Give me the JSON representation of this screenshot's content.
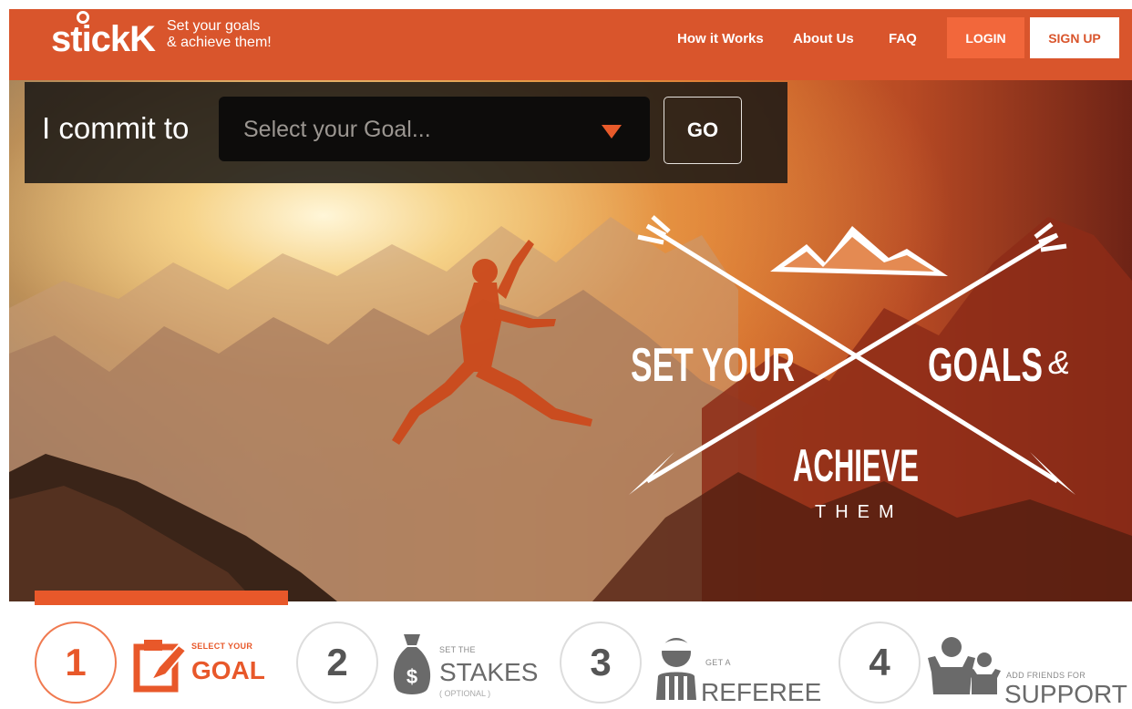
{
  "header": {
    "logo": "stickK",
    "tagline_line1": "Set your goals",
    "tagline_line2": "& achieve them!",
    "nav": [
      "How it Works",
      "About Us",
      "FAQ"
    ],
    "login_label": "LOGIN",
    "signup_label": "SIGN UP"
  },
  "commit": {
    "label": "I commit to",
    "select_placeholder": "Select your Goal...",
    "go_label": "GO"
  },
  "hero": {
    "line1_left": "SET YOUR",
    "line1_right": "GOALS",
    "ampersand": "&",
    "line2": "ACHIEVE",
    "line3": "THEM"
  },
  "steps": [
    {
      "number": "1",
      "small": "SELECT YOUR",
      "big": "GOAL",
      "sub": "",
      "icon": "edit-goal-icon"
    },
    {
      "number": "2",
      "small": "SET THE",
      "big": "STAKES",
      "sub": "( OPTIONAL )",
      "icon": "money-bag-icon"
    },
    {
      "number": "3",
      "small": "GET A",
      "big": "REFEREE",
      "sub": "",
      "icon": "referee-icon"
    },
    {
      "number": "4",
      "small": "ADD FRIENDS FOR",
      "big": "SUPPORT",
      "sub": "",
      "icon": "friends-icon"
    }
  ],
  "colors": {
    "brand": "#d9552c",
    "accent": "#e8582a",
    "commit_bg": "#1a1613"
  }
}
